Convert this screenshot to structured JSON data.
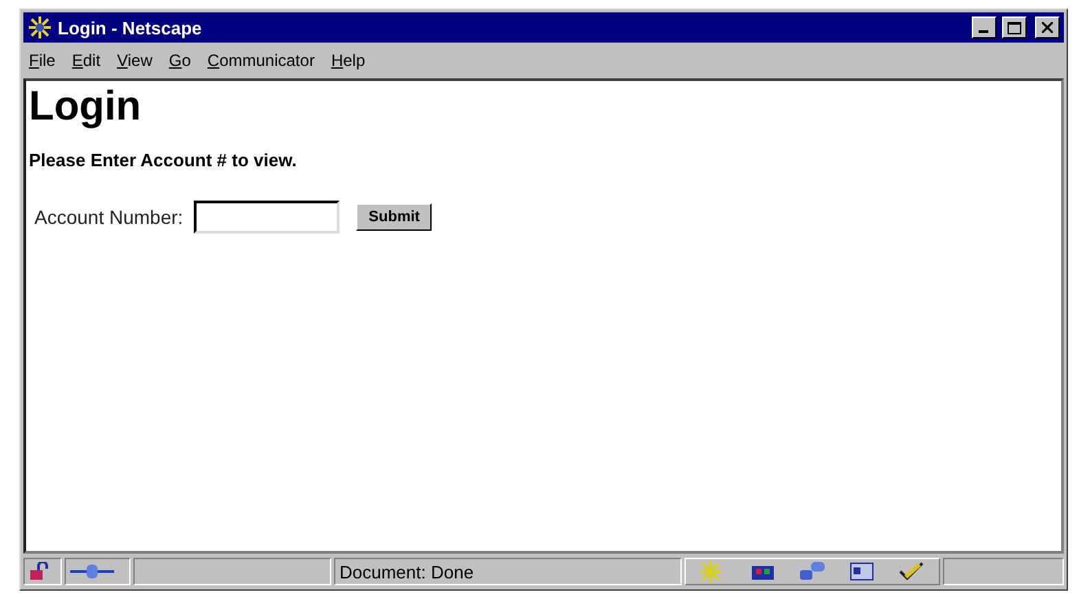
{
  "window": {
    "title": "Login - Netscape"
  },
  "menu": [
    "File",
    "Edit",
    "View",
    "Go",
    "Communicator",
    "Help"
  ],
  "page": {
    "heading": "Login",
    "instruction": "Please Enter Account # to view.",
    "field_label": "Account Number:",
    "button": "Submit"
  },
  "status_bar": {
    "text": "Document: Done"
  }
}
